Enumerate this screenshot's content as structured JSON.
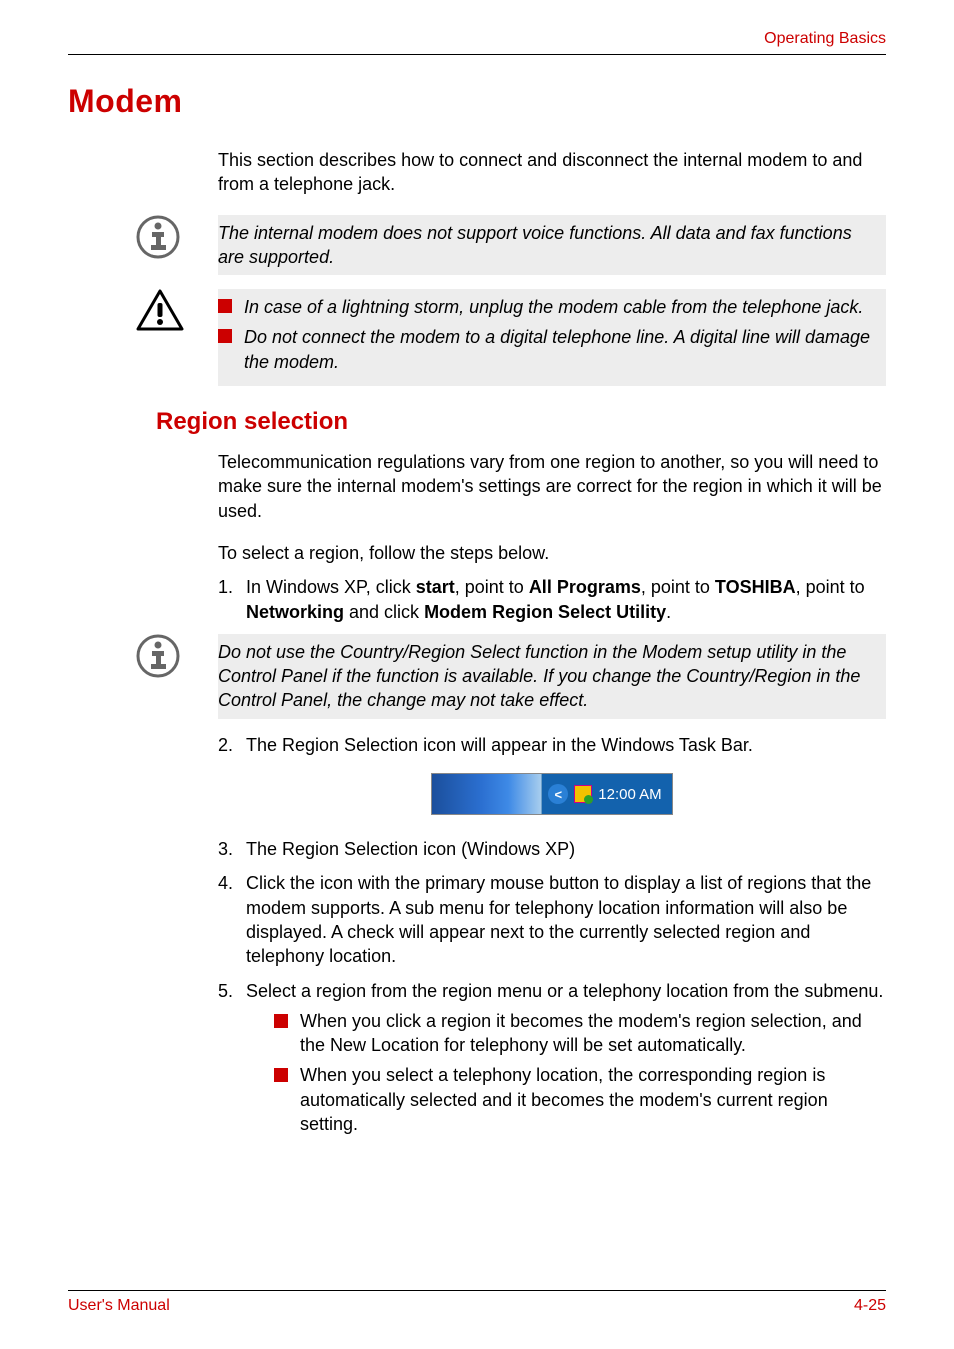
{
  "header": {
    "right": "Operating Basics"
  },
  "section": {
    "title": "Modem"
  },
  "intro": "This section describes how to connect and disconnect the internal modem to and from a telephone jack.",
  "note1": "The internal modem does not support voice functions. All data and fax functions are supported.",
  "warn": {
    "items": [
      "In case of a lightning storm, unplug the modem cable from the telephone jack.",
      "Do not connect the modem to a digital telephone line. A digital line will damage the modem."
    ]
  },
  "subsection": {
    "title": "Region selection"
  },
  "region_intro": "Telecommunication regulations vary from one region to another, so you will need to make sure the internal modem's settings are correct for the region in which it will be used.",
  "region_lead": "To select a region, follow the steps below.",
  "step1": {
    "num": "1.",
    "pre": "In Windows XP, click ",
    "b1": "start",
    "mid1": ", point to ",
    "b2": "All Programs",
    "mid2": ", point to ",
    "b3": "TOSHIBA",
    "mid3": ", point to ",
    "b4": "Networking",
    "mid4": " and click ",
    "b5": "Modem Region Select Utility",
    "end": "."
  },
  "note2": "Do not use the Country/Region Select function in the Modem setup utility in the Control Panel if the function is available. If you change the Country/Region in the Control Panel, the change may not take effect.",
  "step2": {
    "num": "2.",
    "text": "The Region Selection icon will appear in the Windows Task Bar."
  },
  "taskbar": {
    "time": "12:00 AM"
  },
  "step3": {
    "num": "3.",
    "text": "The Region Selection icon (Windows XP)"
  },
  "step4": {
    "num": "4.",
    "text": "Click the icon with the primary mouse button to display a list of regions that the modem supports. A sub menu for telephony location information will also be displayed. A check will appear next to the currently selected region and telephony location."
  },
  "step5": {
    "num": "5.",
    "text": "Select a region from the region menu or a telephony location from the submenu.",
    "sub": [
      "When you click a region it becomes the modem's region selection, and the New Location for telephony will be set automatically.",
      "When you select a telephony location, the corresponding region is automatically selected and it becomes the modem's current region setting."
    ]
  },
  "footer": {
    "left": "User's Manual",
    "right": "4-25"
  },
  "icons": {
    "info": "info-icon",
    "warn": "warning-icon",
    "chevron": "<"
  }
}
